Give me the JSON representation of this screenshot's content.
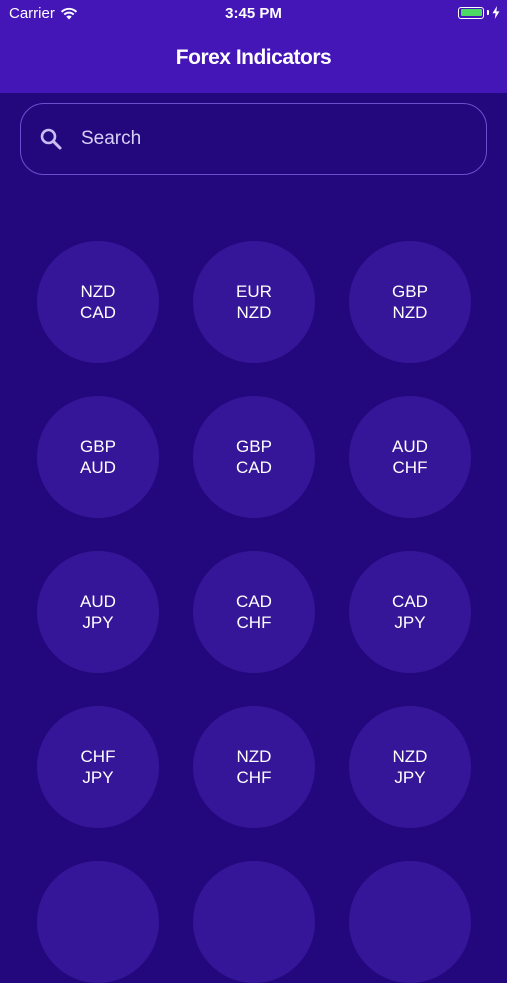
{
  "status_bar": {
    "carrier": "Carrier",
    "time": "3:45 PM",
    "battery_color": "#4cd964"
  },
  "header": {
    "title": "Forex Indicators",
    "color": "#4416b8"
  },
  "search": {
    "placeholder": "Search",
    "icon": "search-icon"
  },
  "pairs": [
    {
      "base": "NZD",
      "quote": "CAD"
    },
    {
      "base": "EUR",
      "quote": "NZD"
    },
    {
      "base": "GBP",
      "quote": "NZD"
    },
    {
      "base": "GBP",
      "quote": "AUD"
    },
    {
      "base": "GBP",
      "quote": "CAD"
    },
    {
      "base": "AUD",
      "quote": "CHF"
    },
    {
      "base": "AUD",
      "quote": "JPY"
    },
    {
      "base": "CAD",
      "quote": "CHF"
    },
    {
      "base": "CAD",
      "quote": "JPY"
    },
    {
      "base": "CHF",
      "quote": "JPY"
    },
    {
      "base": "NZD",
      "quote": "CHF"
    },
    {
      "base": "NZD",
      "quote": "JPY"
    }
  ],
  "colors": {
    "background": "#23087d",
    "tile": "#361698",
    "search_border": "#6b4fd0"
  }
}
